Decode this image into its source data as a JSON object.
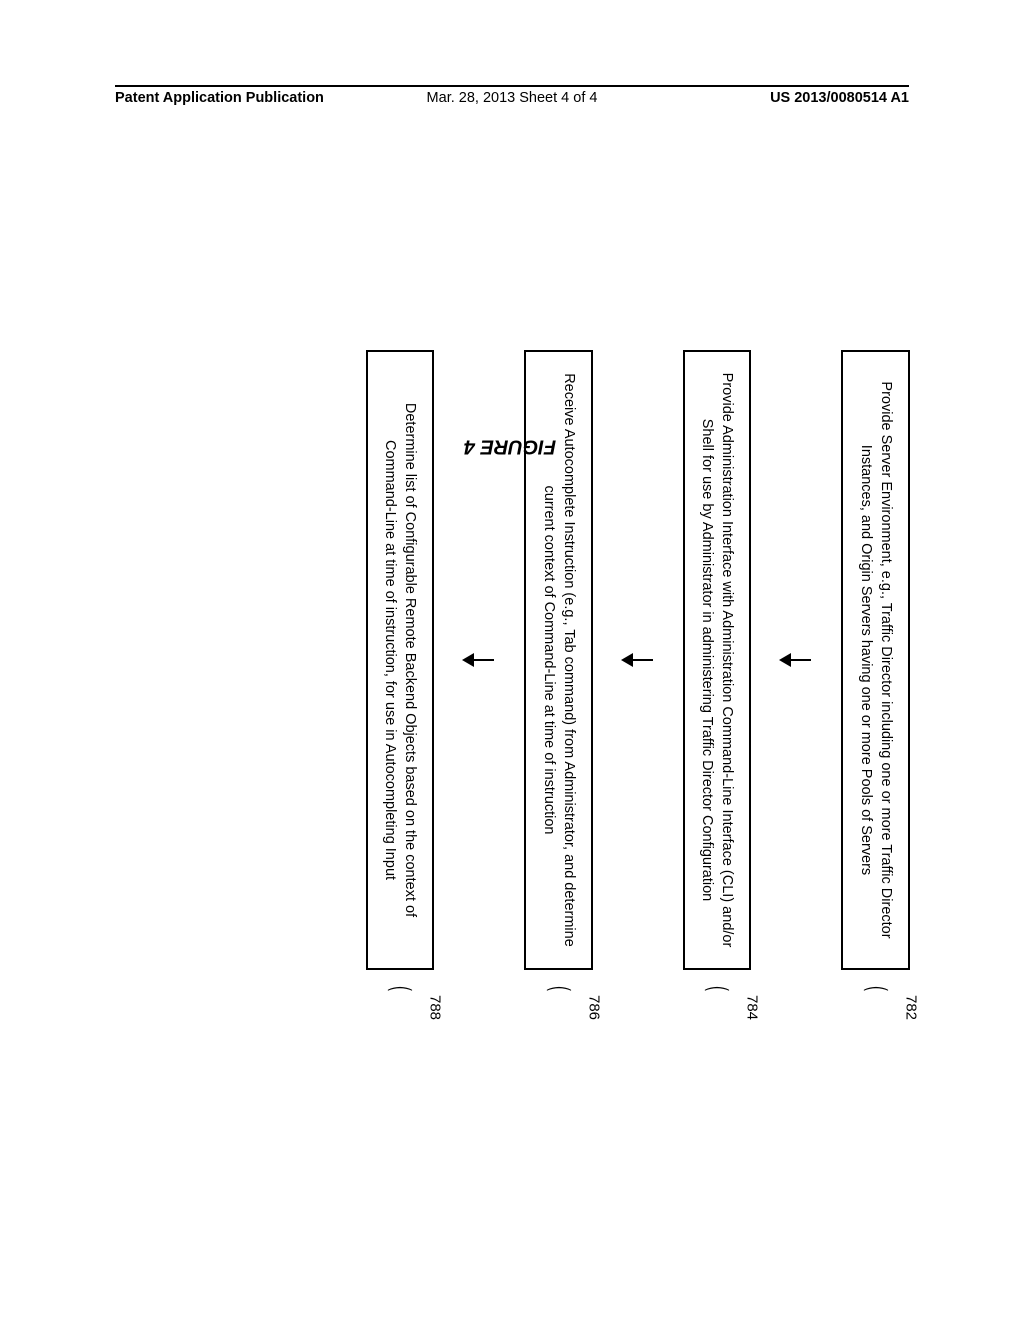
{
  "header": {
    "left": "Patent Application Publication",
    "center": "Mar. 28, 2013  Sheet 4 of 4",
    "right": "US 2013/0080514 A1"
  },
  "figure_label": "FIGURE 4",
  "steps": [
    {
      "ref": "782",
      "text": "Provide Server Environment, e.g., Traffic Director including one or more Traffic Director Instances, and Origin Servers having one or more Pools of Servers"
    },
    {
      "ref": "784",
      "text": "Provide Administration Interface with Administration Command-Line Interface (CLI) and/or Shell for use by Administrator in administering Traffic Director Configuration"
    },
    {
      "ref": "786",
      "text": "Receive Autocomplete Instruction (e.g., Tab command) from Administrator, and determine current context of Command-Line at time of instruction"
    },
    {
      "ref": "788",
      "text": "Determine list of Configurable Remote Backend Objects based on the context of Command-Line at time of instruction, for use in Autocompleting Input"
    }
  ]
}
